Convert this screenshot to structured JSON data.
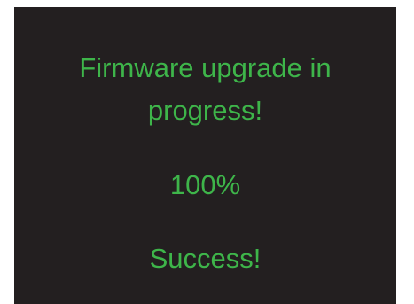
{
  "screen": {
    "title_line1": "Firmware upgrade in",
    "title_line2": "progress!",
    "progress": "100%",
    "result": "Success!"
  },
  "colors": {
    "background": "#231f20",
    "text": "#3eb54a",
    "page": "#ffffff"
  }
}
